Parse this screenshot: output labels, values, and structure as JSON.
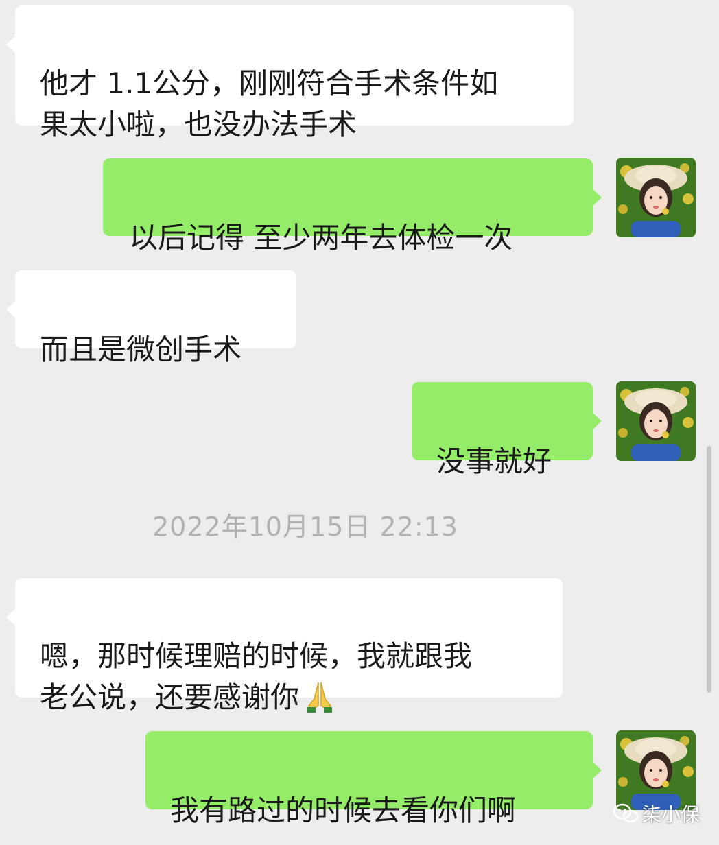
{
  "messages": [
    {
      "side": "in",
      "text": "他才 1.1公分，刚刚符合手术条件如\n果太小啦，也没办法手术"
    },
    {
      "side": "out",
      "text": "以后记得 至少两年去体检一次"
    },
    {
      "side": "in",
      "text": "而且是微创手术"
    },
    {
      "side": "out",
      "text": "没事就好"
    },
    {
      "side": "in",
      "text": "嗯，那时候理赔的时候，我就跟我\n老公说，还要感谢你",
      "emoji": "folded-hands-emoji"
    },
    {
      "side": "out",
      "text": "我有路过的时候去看你们啊"
    }
  ],
  "timestamp": "2022年10月15日 22:13",
  "watermark": {
    "icon": "wechat-official-account-icon",
    "text": "柒小保"
  },
  "colors": {
    "background": "#ededed",
    "incoming_bubble": "#ffffff",
    "outgoing_bubble": "#95ec69",
    "timestamp": "#b2b2b2"
  }
}
